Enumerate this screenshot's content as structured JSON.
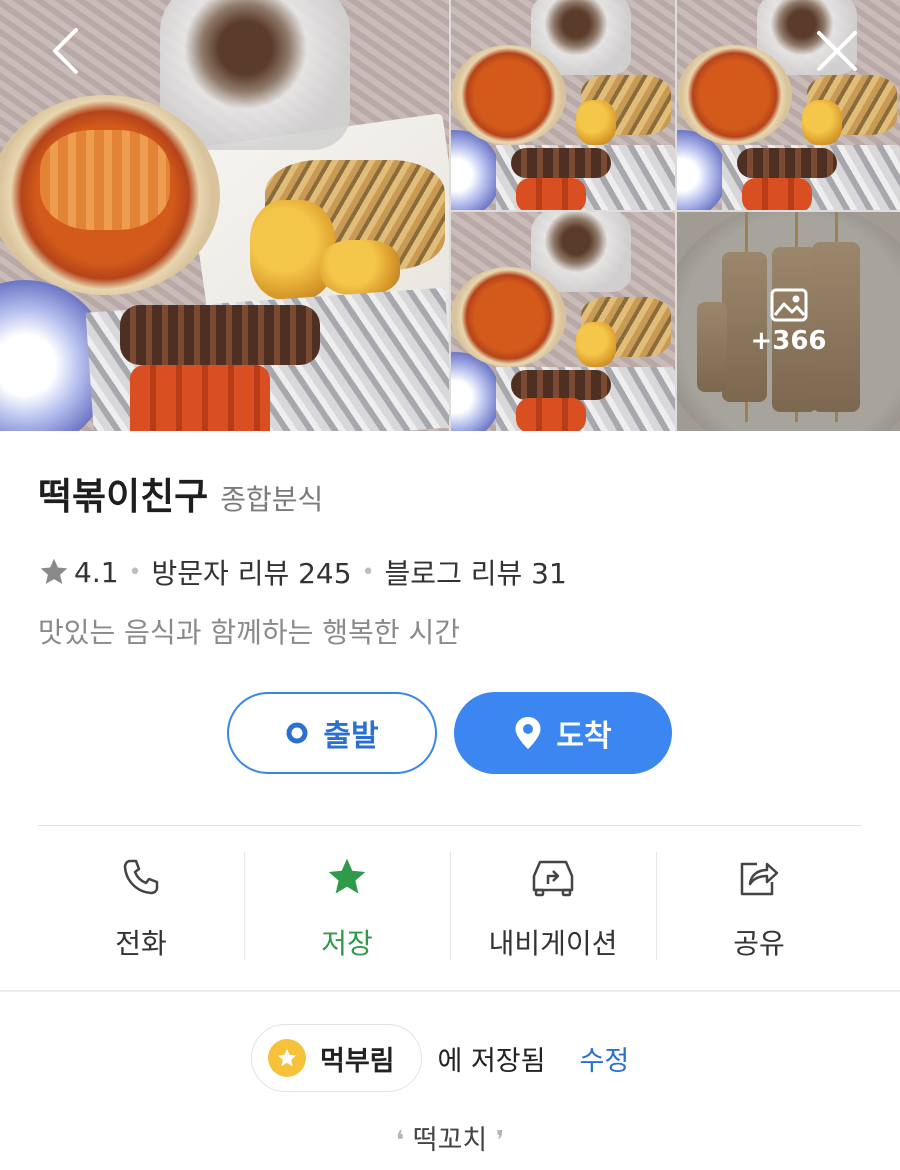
{
  "gallery": {
    "more_count": "+366"
  },
  "place": {
    "name": "떡볶이친구",
    "category": "종합분식",
    "rating": "4.1",
    "visitor_reviews": "방문자 리뷰 245",
    "blog_reviews": "블로그 리뷰 31",
    "description": "맛있는 음식과 함께하는 행복한 시간"
  },
  "route": {
    "depart_label": "출발",
    "arrive_label": "도착"
  },
  "actions": {
    "call": "전화",
    "save": "저장",
    "navigation": "내비게이션",
    "share": "공유"
  },
  "saved": {
    "folder": "먹부림",
    "text": "에 저장됨",
    "edit": "수정",
    "memo": "떡꼬치"
  },
  "colors": {
    "primary_blue": "#3b86f0",
    "save_green": "#2f9a4a",
    "folder_yellow": "#f6c23a"
  }
}
